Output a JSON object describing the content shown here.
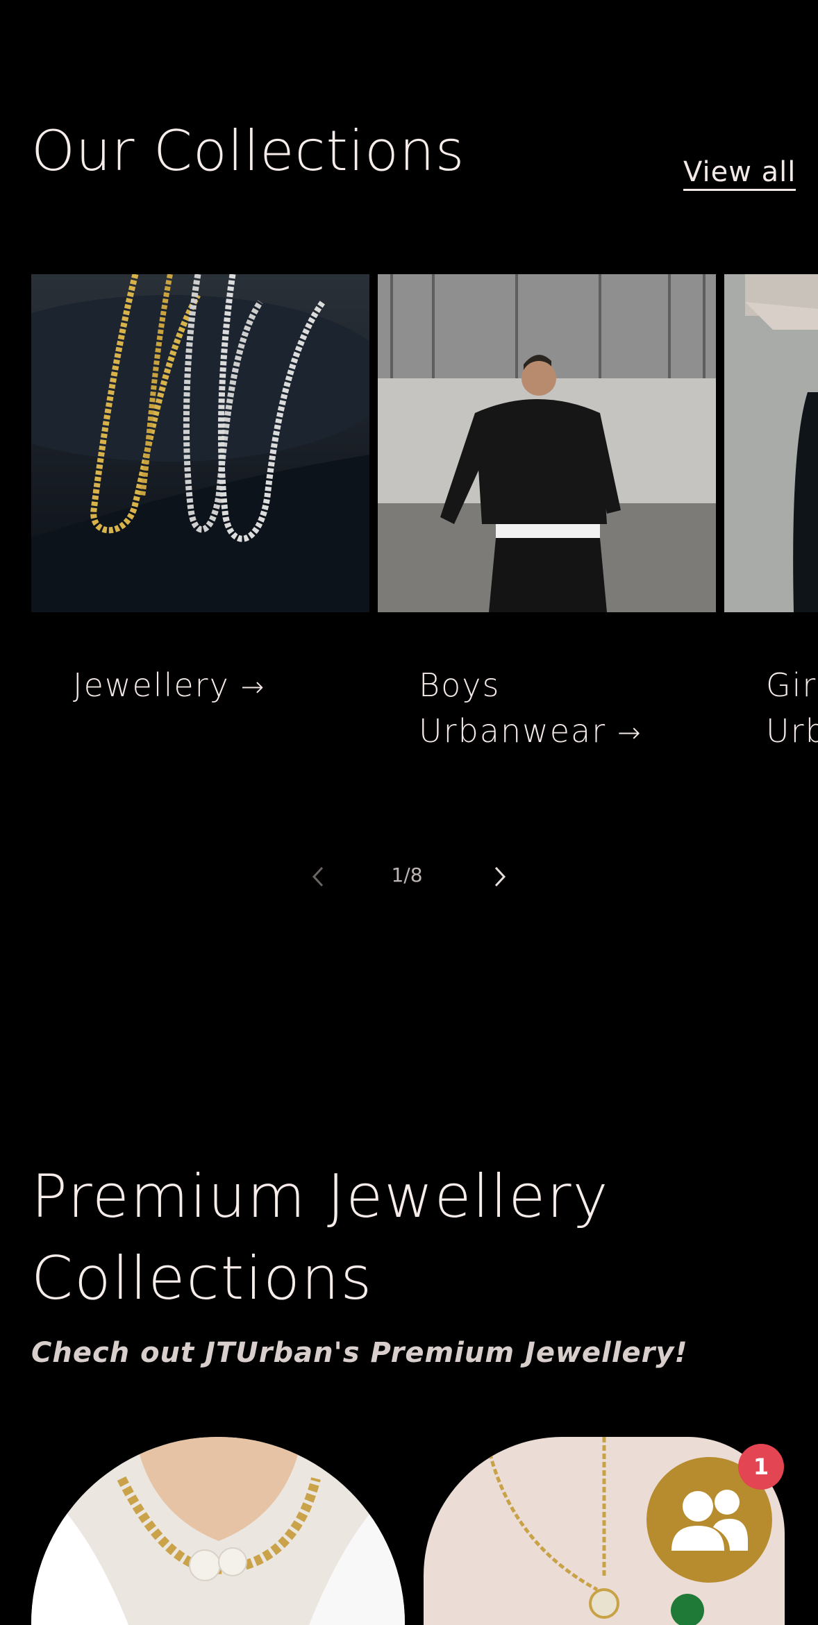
{
  "collections": {
    "title": "Our Collections",
    "view_all": "View all",
    "cards": [
      {
        "label_line1": "Jewellery",
        "label_line2": "",
        "arrow": "→"
      },
      {
        "label_line1": "Boys",
        "label_line2": "Urbanwear",
        "arrow": "→"
      },
      {
        "label_line1": "Girl",
        "label_line2": "Urb"
      }
    ],
    "pagination": {
      "counter": "1/8",
      "current": 1,
      "total": 8
    }
  },
  "premium": {
    "title_line1": "Premium Jewellery",
    "title_line2": "Collections",
    "subtitle": "Chech out JTUrban's Premium Jewellery!"
  },
  "chat": {
    "badge_count": "1",
    "icon": "users-icon",
    "accent": "#b78c2e",
    "badge_color": "#e34553"
  }
}
